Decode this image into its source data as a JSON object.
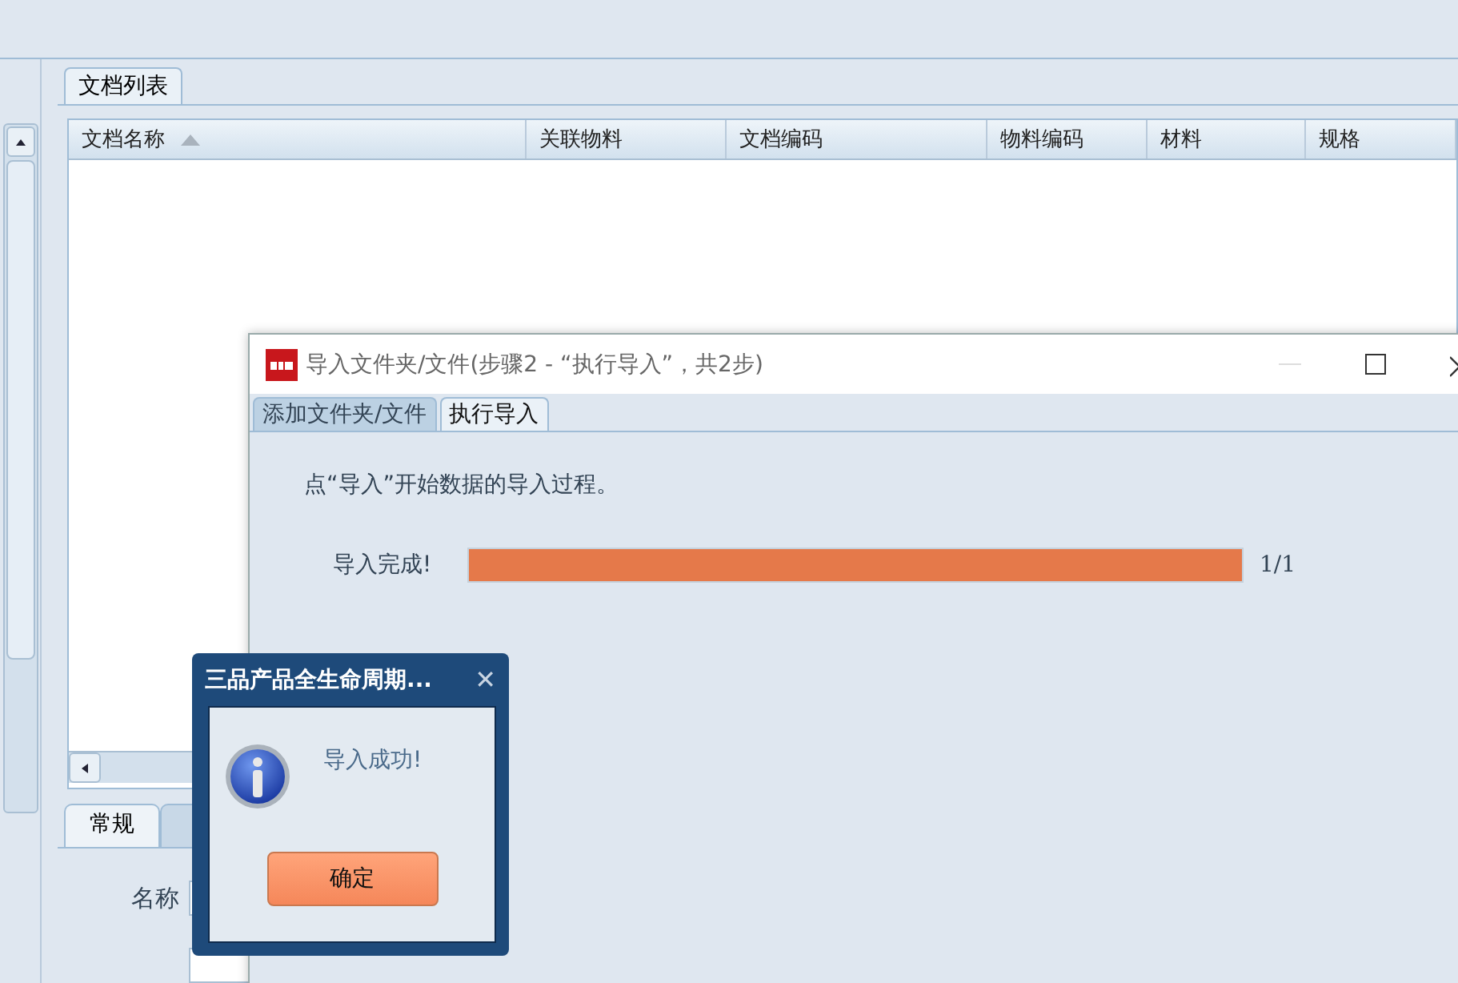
{
  "doc_panel": {
    "tabs": [
      {
        "label": "文档列表",
        "selected": true
      }
    ],
    "table": {
      "columns": [
        {
          "label": "文档名称",
          "sorted": true
        },
        {
          "label": "关联物料",
          "sorted": false
        },
        {
          "label": "文档编码",
          "sorted": false
        },
        {
          "label": "物料编码",
          "sorted": false
        },
        {
          "label": "材料",
          "sorted": false
        },
        {
          "label": "规格",
          "sorted": false
        }
      ]
    }
  },
  "detail_panel": {
    "tabs": [
      {
        "label": "常规",
        "selected": true
      },
      {
        "selected": false
      }
    ],
    "fields": [
      {
        "label": "名称"
      }
    ]
  },
  "import_window": {
    "title": "导入文件夹/文件(步骤2 - “执行导入”，共2步)",
    "tabs": [
      {
        "label": "添加文件夹/文件",
        "selected": false
      },
      {
        "label": "执行导入",
        "selected": true
      }
    ],
    "instruction": "点“导入”开始数据的导入过程。",
    "progress": {
      "label": "导入完成!",
      "level": 1,
      "reading": "1/1"
    }
  },
  "message_dialog": {
    "title": "三品产品全生命周期...",
    "close": "✕",
    "message": "导入成功!",
    "button": "确定"
  }
}
